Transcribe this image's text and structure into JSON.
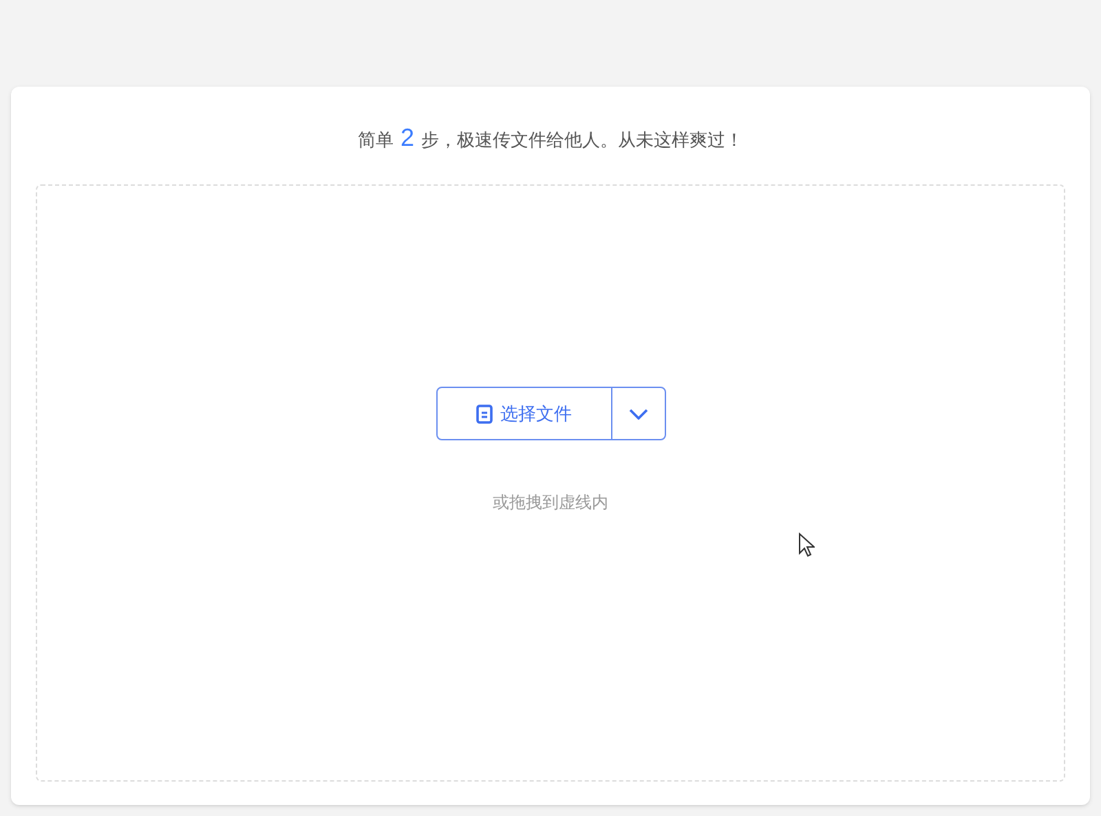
{
  "headline": {
    "before": "简单",
    "number": "2",
    "after": "步，极速传文件给他人。从未这样爽过！"
  },
  "upload": {
    "button": "选择文件",
    "hint": "或拖拽到虚线内"
  }
}
